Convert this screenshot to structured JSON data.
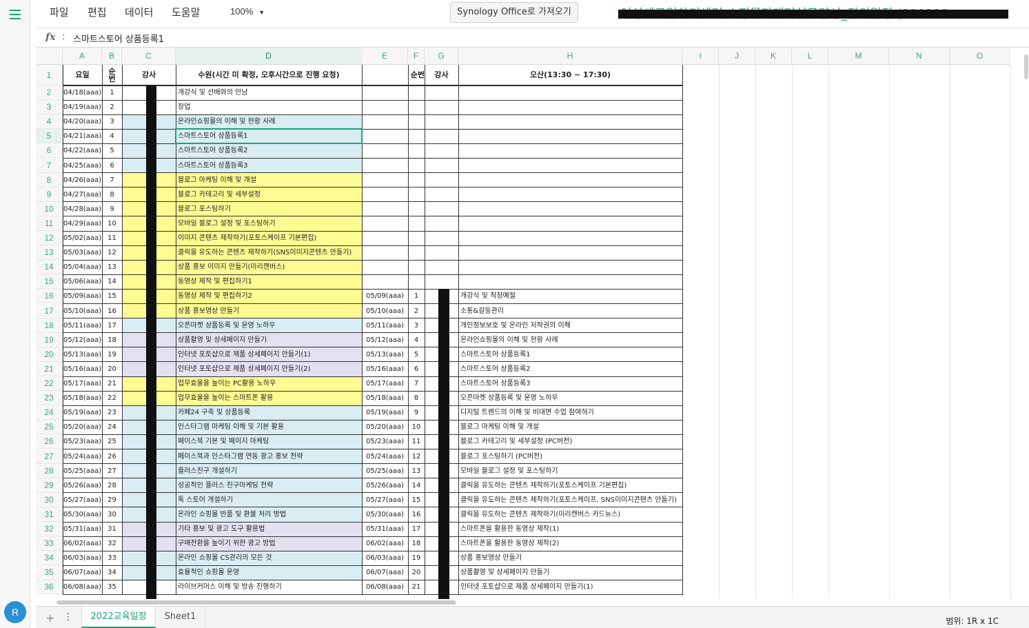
{
  "menubar": {
    "items": [
      "파일",
      "편집",
      "데이터",
      "도움말"
    ],
    "zoom": "100%",
    "synology_button": "Synology Office로 가져오기",
    "doc_title": "여성새로일하기센터 쇼핑몰마케터실무양성_강의일정 (220321",
    "doc_title_overflow": "..."
  },
  "formula": {
    "fx": "fx",
    "colon": ":",
    "value": "스마트스토어 상품등록1"
  },
  "columns": [
    "A",
    "B",
    "C",
    "D",
    "E",
    "F",
    "G",
    "H",
    "I",
    "J",
    "K",
    "L",
    "M",
    "N",
    "O"
  ],
  "header_row": {
    "A": "요일",
    "B": "순\n번",
    "C": "강사",
    "D": "수원(시간 미 확정, 오후시간으로 진행 요청)",
    "F": "순번",
    "G": "강사",
    "H": "오산(13:30 ~ 17:30)"
  },
  "rows": [
    {
      "n": "2",
      "A": "04/18(aaa)",
      "B": "1",
      "C": "",
      "D": "개강식 및 선배와의 만남",
      "E": "",
      "F": "",
      "G": "",
      "H": "",
      "cbg": "",
      "dbg": ""
    },
    {
      "n": "3",
      "A": "04/19(aaa)",
      "B": "2",
      "C": "",
      "D": "창업",
      "E": "",
      "F": "",
      "G": "",
      "H": "",
      "cbg": "",
      "dbg": ""
    },
    {
      "n": "4",
      "A": "04/20(aaa)",
      "B": "3",
      "C": "",
      "D": "온라인쇼핑몰의 이해 및 현황 사례",
      "E": "",
      "F": "",
      "G": "",
      "H": "",
      "cbg": "blue",
      "dbg": "blue"
    },
    {
      "n": "5",
      "A": "04/21(aaa)",
      "B": "4",
      "C": "",
      "D": "스마트스토어 상품등록1",
      "E": "",
      "F": "",
      "G": "",
      "H": "",
      "cbg": "blue",
      "dbg": "blue"
    },
    {
      "n": "6",
      "A": "04/22(aaa)",
      "B": "5",
      "C": "",
      "D": "스마트스토어 상품등록2",
      "E": "",
      "F": "",
      "G": "",
      "H": "",
      "cbg": "blue",
      "dbg": "blue"
    },
    {
      "n": "7",
      "A": "04/25(aaa)",
      "B": "6",
      "C": "",
      "D": "스마트스토어 상품등록3",
      "E": "",
      "F": "",
      "G": "",
      "H": "",
      "cbg": "blue",
      "dbg": "blue"
    },
    {
      "n": "8",
      "A": "04/26(aaa)",
      "B": "7",
      "C": "",
      "D": "블로그 마케팅 이해 및 개설",
      "E": "",
      "F": "",
      "G": "",
      "H": "",
      "cbg": "yellow",
      "dbg": "yellow"
    },
    {
      "n": "9",
      "A": "04/27(aaa)",
      "B": "8",
      "C": "",
      "D": "블로그 카테고리 및 세부설정",
      "E": "",
      "F": "",
      "G": "",
      "H": "",
      "cbg": "yellow",
      "dbg": "yellow"
    },
    {
      "n": "10",
      "A": "04/28(aaa)",
      "B": "9",
      "C": "",
      "D": "블로그 포스팅하기",
      "E": "",
      "F": "",
      "G": "",
      "H": "",
      "cbg": "yellow",
      "dbg": "yellow"
    },
    {
      "n": "11",
      "A": "04/29(aaa)",
      "B": "10",
      "C": "",
      "D": "모바일 블로그 설정 및 포스팅하기",
      "E": "",
      "F": "",
      "G": "",
      "H": "",
      "cbg": "yellow",
      "dbg": "yellow"
    },
    {
      "n": "12",
      "A": "05/02(aaa)",
      "B": "11",
      "C": "",
      "D": "이미지 콘텐츠 제작하기(포토스케이프 기본편집)",
      "E": "",
      "F": "",
      "G": "",
      "H": "",
      "cbg": "yellow",
      "dbg": "yellow"
    },
    {
      "n": "13",
      "A": "05/03(aaa)",
      "B": "12",
      "C": "",
      "D": "클릭을 유도하는 콘텐츠 제작하기(SNS이미지콘텐츠 만들기)",
      "E": "",
      "F": "",
      "G": "",
      "H": "",
      "cbg": "yellow",
      "dbg": "yellow"
    },
    {
      "n": "14",
      "A": "05/04(aaa)",
      "B": "13",
      "C": "",
      "D": "상품 홍보 이미지 만들기(미리캔버스)",
      "E": "",
      "F": "",
      "G": "",
      "H": "",
      "cbg": "yellow",
      "dbg": "yellow"
    },
    {
      "n": "15",
      "A": "05/06(aaa)",
      "B": "14",
      "C": "",
      "D": "동영상 제작 및 편집하기1",
      "E": "",
      "F": "",
      "G": "",
      "H": "",
      "cbg": "yellow",
      "dbg": "yellow"
    },
    {
      "n": "16",
      "A": "05/09(aaa)",
      "B": "15",
      "C": "",
      "D": "동영상 제작 및 편집하기2",
      "E": "05/09(aaa)",
      "F": "1",
      "G": "",
      "H": "개강식 및 직장예절",
      "cbg": "yellow",
      "dbg": "yellow"
    },
    {
      "n": "17",
      "A": "05/10(aaa)",
      "B": "16",
      "C": "",
      "D": "상품 홍보영상 만들기",
      "E": "05/10(aaa)",
      "F": "2",
      "G": "",
      "H": "소통&갈등관리",
      "cbg": "yellow",
      "dbg": "yellow"
    },
    {
      "n": "18",
      "A": "05/11(aaa)",
      "B": "17",
      "C": "",
      "D": "오픈마켓 상품등록 및 운영 노하우",
      "E": "05/11(aaa)",
      "F": "3",
      "G": "",
      "H": "개인정보보호 및 온라인 저작권의 이해",
      "cbg": "blue",
      "dbg": "blue"
    },
    {
      "n": "19",
      "A": "05/12(aaa)",
      "B": "18",
      "C": "",
      "D": "상품촬영 및 상세페이지 만들기",
      "E": "05/12(aaa)",
      "F": "4",
      "G": "",
      "H": "온라인쇼핑몰의 이해 및 현황 사례",
      "cbg": "purple",
      "dbg": "purple"
    },
    {
      "n": "20",
      "A": "05/13(aaa)",
      "B": "19",
      "C": "",
      "D": "인터넷 포토샵으로 제품 상세페이지 만들기(1)",
      "E": "05/13(aaa)",
      "F": "5",
      "G": "",
      "H": "스마트스토어 상품등록1",
      "cbg": "purple",
      "dbg": "purple"
    },
    {
      "n": "21",
      "A": "05/16(aaa)",
      "B": "20",
      "C": "",
      "D": "인터넷 포토샵으로 제품 상세페이지 만들기(2)",
      "E": "05/16(aaa)",
      "F": "6",
      "G": "",
      "H": " 스마트스토어 상품등록2",
      "cbg": "purple",
      "dbg": "purple"
    },
    {
      "n": "22",
      "A": "05/17(aaa)",
      "B": "21",
      "C": "",
      "D": "업무효율을 높이는 PC활용 노하우",
      "E": "05/17(aaa)",
      "F": "7",
      "G": "",
      "H": "스마트스토어 상품등록3",
      "cbg": "yellow",
      "dbg": "yellow"
    },
    {
      "n": "23",
      "A": "05/18(aaa)",
      "B": "22",
      "C": "",
      "D": "업무효율을 높이는 스마트폰 활용",
      "E": "05/18(aaa)",
      "F": "8",
      "G": "",
      "H": "오픈마켓 상품등록 및 운영 노하우",
      "cbg": "yellow",
      "dbg": "yellow"
    },
    {
      "n": "24",
      "A": "05/19(aaa)",
      "B": "23",
      "C": "",
      "D": "카페24 구축 및 상품등록",
      "E": "05/19(aaa)",
      "F": "9",
      "G": "",
      "H": "디지털 트렌드의 이해 및 비대면 수업 참여하기",
      "cbg": "blue",
      "dbg": "blue"
    },
    {
      "n": "25",
      "A": "05/20(aaa)",
      "B": "24",
      "C": "",
      "D": "인스타그램 마케팅 이해 및 기본 활용",
      "E": "05/20(aaa)",
      "F": "10",
      "G": "",
      "H": "블로그 마케팅 이해 및 개설",
      "cbg": "blue",
      "dbg": "blue"
    },
    {
      "n": "26",
      "A": "05/23(aaa)",
      "B": "25",
      "C": "",
      "D": "페이스북 기본 및 페이지 마케팅",
      "E": "05/23(aaa)",
      "F": "11",
      "G": "",
      "H": "블로그 카테고리 및 세부설정 (PC버전)",
      "cbg": "blue",
      "dbg": "blue"
    },
    {
      "n": "27",
      "A": "05/24(aaa)",
      "B": "26",
      "C": "",
      "D": "페이스북과 인스타그램 연동 광고 홍보 전략",
      "E": "05/24(aaa)",
      "F": "12",
      "G": "",
      "H": "블로그 포스팅하기 (PC버전)",
      "cbg": "blue",
      "dbg": "blue"
    },
    {
      "n": "28",
      "A": "05/25(aaa)",
      "B": "27",
      "C": "",
      "D": "플러스친구 개설하기",
      "E": "05/25(aaa)",
      "F": "13",
      "G": "",
      "H": "모바일 블로그 설정 및 포스팅하기",
      "cbg": "blue",
      "dbg": "blue"
    },
    {
      "n": "29",
      "A": "05/26(aaa)",
      "B": "28",
      "C": "",
      "D": "성공적인 플러스 친구마케팅 전략",
      "E": "05/26(aaa)",
      "F": "14",
      "G": "",
      "H": "클릭을 유도하는 콘텐츠 제작하기(포토스케이프 기본편집)",
      "cbg": "blue",
      "dbg": "blue"
    },
    {
      "n": "30",
      "A": "05/27(aaa)",
      "B": "29",
      "C": "",
      "D": "톡 스토어 개설하기",
      "E": "05/27(aaa)",
      "F": "15",
      "G": "",
      "H": "클릭을 유도하는 콘텐츠 제작하기(포토스케이프, SNS이미지콘텐츠 만들기)",
      "cbg": "blue",
      "dbg": "blue"
    },
    {
      "n": "31",
      "A": "05/30(aaa)",
      "B": "30",
      "C": "",
      "D": "온라인 쇼핑몰  반품 및 환불 처리 방법",
      "E": "05/30(aaa)",
      "F": "16",
      "G": "",
      "H": "클릭을 유도하는 콘텐츠 제작하기(미리캔버스 카드뉴스)",
      "cbg": "blue",
      "dbg": "blue"
    },
    {
      "n": "32",
      "A": "05/31(aaa)",
      "B": "31",
      "C": "",
      "D": "기타 홍보 및 광고 도구 활용법",
      "E": "05/31(aaa)",
      "F": "17",
      "G": "",
      "H": "스마트폰을 활용한 동영상 제작(1)",
      "cbg": "purple",
      "dbg": "purple"
    },
    {
      "n": "33",
      "A": "06/02(aaa)",
      "B": "32",
      "C": "",
      "D": "구매전환을 높이기 위한 광고 방법",
      "E": "06/02(aaa)",
      "F": "18",
      "G": "",
      "H": "스마트폰을 활용한 동영상 제작(2)",
      "cbg": "purple",
      "dbg": "purple"
    },
    {
      "n": "34",
      "A": "06/03(aaa)",
      "B": "33",
      "C": "",
      "D": "온라인 쇼핑몰  CS관리의 모든 것",
      "E": "06/03(aaa)",
      "F": "19",
      "G": "",
      "H": "상품 홍보영상 만들기",
      "cbg": "blue",
      "dbg": "blue"
    },
    {
      "n": "35",
      "A": "06/07(aaa)",
      "B": "34",
      "C": "",
      "D": "효율적인 쇼핑몰 운영",
      "E": "06/07(aaa)",
      "F": "20",
      "G": "",
      "H": "상품촬영 및 상세페이지 만들기",
      "cbg": "blue",
      "dbg": "blue"
    },
    {
      "n": "36",
      "A": "06/08(aaa)",
      "B": "35",
      "C": "",
      "D": "라이브커머스 이해 및 방송 진행하기",
      "E": "06/08(aaa)",
      "F": "21",
      "G": "",
      "H": "인터넷 포토샵으로 제품 상세페이지 만들기(1)",
      "cbg": "",
      "dbg": ""
    }
  ],
  "sheet_tabs": {
    "add": "+",
    "menu": "⋮",
    "tabs": [
      "2022교육일정",
      "Sheet1"
    ]
  },
  "status": {
    "range": "범위: 1R x 1C"
  },
  "user": {
    "avatar_letter": "R"
  },
  "colors": {
    "accent": "#1aa37a",
    "blue": "#d9edf3",
    "yellow": "#fdfb91",
    "purple": "#e5e0ef"
  }
}
